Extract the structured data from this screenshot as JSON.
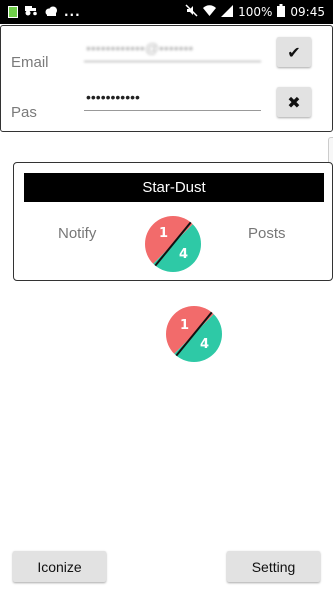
{
  "status_bar": {
    "left_icons": [
      "gallery-icon",
      "tractor-icon",
      "cloud-icon"
    ],
    "overflow": "...",
    "battery": "100%",
    "time": "09:45",
    "right_icons": [
      "mute-icon",
      "wifi-icon",
      "signal-icon",
      "battery-icon"
    ]
  },
  "login": {
    "email_label": "Email",
    "email_value": "••••••••••••@•••••••",
    "password_label": "Pas",
    "password_value": "•••••••••••",
    "confirm_glyph": "✔",
    "clear_glyph": "✖"
  },
  "card": {
    "title": "Star-Dust",
    "left_label": "Notify",
    "right_label": "Posts",
    "badge": {
      "top": "1",
      "bottom": "4"
    }
  },
  "standalone_badge": {
    "top": "1",
    "bottom": "4"
  },
  "colors": {
    "badge_top": "#f26b6b",
    "badge_bottom": "#2ec9a6",
    "title_bar": "#000000"
  },
  "buttons": {
    "left": "Iconize",
    "right": "Setting"
  }
}
